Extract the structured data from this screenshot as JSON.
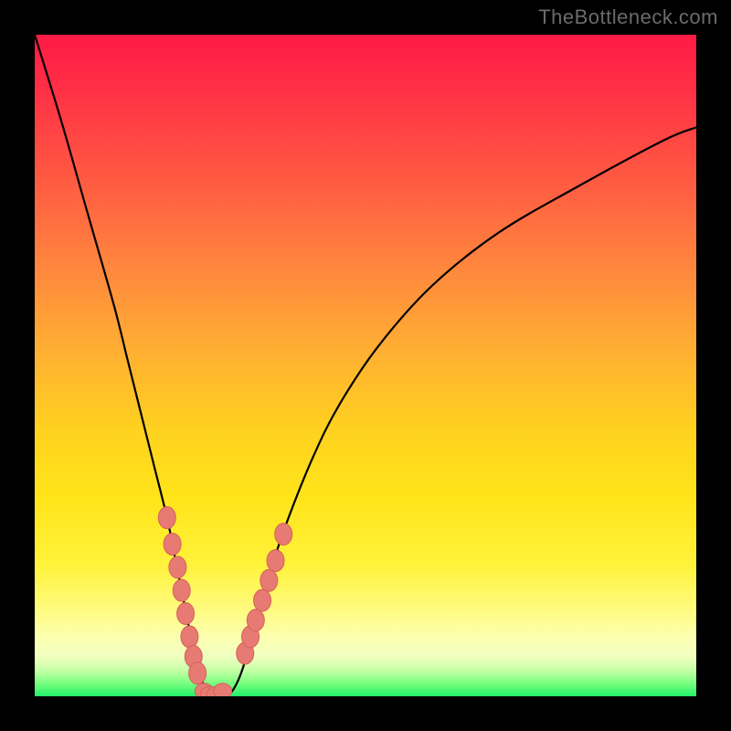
{
  "watermark": {
    "text": "TheBottleneck.com"
  },
  "colors": {
    "background_frame": "#000000",
    "curve_stroke": "#000000",
    "marker_fill": "#e77a72",
    "marker_stroke": "#d5625a",
    "gradient_top": "#ff1a46",
    "gradient_bottom": "#22ef6a"
  },
  "chart_data": {
    "type": "line",
    "title": "",
    "subtitle": "",
    "xlabel": "",
    "ylabel": "",
    "xlim": [
      0,
      100
    ],
    "ylim": [
      0,
      100
    ],
    "grid": false,
    "legend_position": "none",
    "annotations": [],
    "series": [
      {
        "name": "bottleneck-curve",
        "x": [
          0,
          4,
          8,
          12,
          14,
          16,
          18,
          20,
          21,
          22,
          23,
          24,
          25,
          26,
          27,
          28,
          29,
          30,
          31,
          32,
          33,
          35,
          38,
          42,
          46,
          52,
          60,
          70,
          82,
          95,
          100
        ],
        "values": [
          100,
          87,
          73,
          59,
          51,
          43,
          35,
          27,
          22,
          17,
          12,
          7,
          3,
          1,
          0,
          0,
          0,
          1,
          3,
          6,
          10,
          17,
          26,
          36,
          44,
          53,
          62,
          70,
          77,
          84,
          86
        ]
      }
    ],
    "markers": {
      "name": "highlighted-points",
      "left_cluster": {
        "x": [
          20.0,
          20.8,
          21.6,
          22.2,
          22.8,
          23.4,
          24.0,
          24.6
        ],
        "y": [
          27.0,
          23.0,
          19.5,
          16.0,
          12.5,
          9.0,
          6.0,
          3.5
        ]
      },
      "valley": {
        "x": [
          25.6,
          26.4,
          27.4,
          28.4
        ],
        "y": [
          0.8,
          0.3,
          0.3,
          0.8
        ]
      },
      "right_cluster": {
        "x": [
          31.8,
          32.6,
          33.4,
          34.4,
          35.4,
          36.4,
          37.6
        ],
        "y": [
          6.5,
          9.0,
          11.5,
          14.5,
          17.5,
          20.5,
          24.5
        ]
      }
    }
  }
}
